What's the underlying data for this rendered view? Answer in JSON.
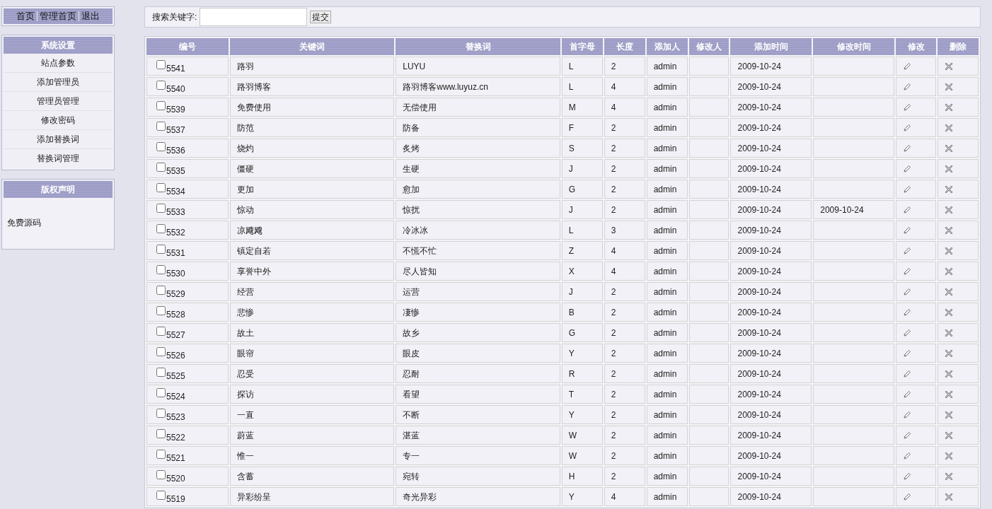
{
  "nav": {
    "links": [
      "首页",
      "管理首页",
      "退出"
    ]
  },
  "menu": {
    "title": "系统设置",
    "items": [
      "站点参数",
      "添加管理员",
      "管理员管理",
      "修改密码",
      "添加替换词",
      "替换词管理"
    ]
  },
  "copyright": {
    "title": "版权声明",
    "text": "免费源码"
  },
  "search": {
    "label": "搜索关键字:",
    "button": "提交"
  },
  "table": {
    "columns": [
      "编号",
      "关键词",
      "替换词",
      "首字母",
      "长度",
      "添加人",
      "修改人",
      "添加时间",
      "修改时间",
      "修改",
      "删除"
    ],
    "rows": [
      {
        "id": "5541",
        "keyword": "路羽",
        "replacement": "LUYU",
        "initial": "L",
        "length": "2",
        "added_by": "admin",
        "added_time": "2009-10-24",
        "checked": false
      },
      {
        "id": "5540",
        "keyword": "路羽博客",
        "replacement": "路羽博客www.luyuz.cn",
        "initial": "L",
        "length": "4",
        "added_by": "admin",
        "added_time": "2009-10-24",
        "checked": false
      },
      {
        "id": "5539",
        "keyword": "免费使用",
        "replacement": "无偿使用",
        "initial": "M",
        "length": "4",
        "added_by": "admin",
        "added_time": "2009-10-24",
        "checked": false
      },
      {
        "id": "5537",
        "keyword": "防范",
        "replacement": "防备",
        "initial": "F",
        "length": "2",
        "added_by": "admin",
        "added_time": "2009-10-24",
        "checked": false
      },
      {
        "id": "5536",
        "keyword": "烧灼",
        "replacement": "炙烤",
        "initial": "S",
        "length": "2",
        "added_by": "admin",
        "added_time": "2009-10-24",
        "checked": false
      },
      {
        "id": "5535",
        "keyword": "僵硬",
        "replacement": "生硬",
        "initial": "J",
        "length": "2",
        "added_by": "admin",
        "added_time": "2009-10-24",
        "checked": false
      },
      {
        "id": "5534",
        "keyword": "更加",
        "replacement": "愈加",
        "initial": "G",
        "length": "2",
        "added_by": "admin",
        "added_time": "2009-10-24",
        "checked": false
      },
      {
        "id": "5533",
        "keyword": "惊动",
        "replacement": "惊扰",
        "initial": "J",
        "length": "2",
        "added_by": "admin",
        "added_time": "2009-10-24",
        "modified_time": "2009-10-24",
        "checked": false
      },
      {
        "id": "5532",
        "keyword": "凉飕飕",
        "replacement": "冷冰冰",
        "initial": "L",
        "length": "3",
        "added_by": "admin",
        "added_time": "2009-10-24",
        "checked": false
      },
      {
        "id": "5531",
        "keyword": "镇定自若",
        "replacement": "不慌不忙",
        "initial": "Z",
        "length": "4",
        "added_by": "admin",
        "added_time": "2009-10-24",
        "checked": false
      },
      {
        "id": "5530",
        "keyword": "享誉中外",
        "replacement": "尽人皆知",
        "initial": "X",
        "length": "4",
        "added_by": "admin",
        "added_time": "2009-10-24",
        "checked": false
      },
      {
        "id": "5529",
        "keyword": "经营",
        "replacement": "运营",
        "initial": "J",
        "length": "2",
        "added_by": "admin",
        "added_time": "2009-10-24",
        "checked": false
      },
      {
        "id": "5528",
        "keyword": "悲惨",
        "replacement": "凄惨",
        "initial": "B",
        "length": "2",
        "added_by": "admin",
        "added_time": "2009-10-24",
        "checked": false
      },
      {
        "id": "5527",
        "keyword": "故土",
        "replacement": "故乡",
        "initial": "G",
        "length": "2",
        "added_by": "admin",
        "added_time": "2009-10-24",
        "checked": false
      },
      {
        "id": "5526",
        "keyword": "眼帘",
        "replacement": "眼皮",
        "initial": "Y",
        "length": "2",
        "added_by": "admin",
        "added_time": "2009-10-24",
        "checked": false
      },
      {
        "id": "5525",
        "keyword": "忍受",
        "replacement": "忍耐",
        "initial": "R",
        "length": "2",
        "added_by": "admin",
        "added_time": "2009-10-24",
        "checked": false
      },
      {
        "id": "5524",
        "keyword": "探访",
        "replacement": "看望",
        "initial": "T",
        "length": "2",
        "added_by": "admin",
        "added_time": "2009-10-24",
        "checked": false
      },
      {
        "id": "5523",
        "keyword": "一直",
        "replacement": "不断",
        "initial": "Y",
        "length": "2",
        "added_by": "admin",
        "added_time": "2009-10-24",
        "checked": false
      },
      {
        "id": "5522",
        "keyword": "蔚蓝",
        "replacement": "湛蓝",
        "initial": "W",
        "length": "2",
        "added_by": "admin",
        "added_time": "2009-10-24",
        "checked": false
      },
      {
        "id": "5521",
        "keyword": "惟一",
        "replacement": "专一",
        "initial": "W",
        "length": "2",
        "added_by": "admin",
        "added_time": "2009-10-24",
        "checked": false
      },
      {
        "id": "5520",
        "keyword": "含蓄",
        "replacement": "宛转",
        "initial": "H",
        "length": "2",
        "added_by": "admin",
        "added_time": "2009-10-24",
        "checked": false
      },
      {
        "id": "5519",
        "keyword": "异彩纷呈",
        "replacement": "奇光异彩",
        "initial": "Y",
        "length": "4",
        "added_by": "admin",
        "added_time": "2009-10-24",
        "checked": false
      }
    ]
  }
}
